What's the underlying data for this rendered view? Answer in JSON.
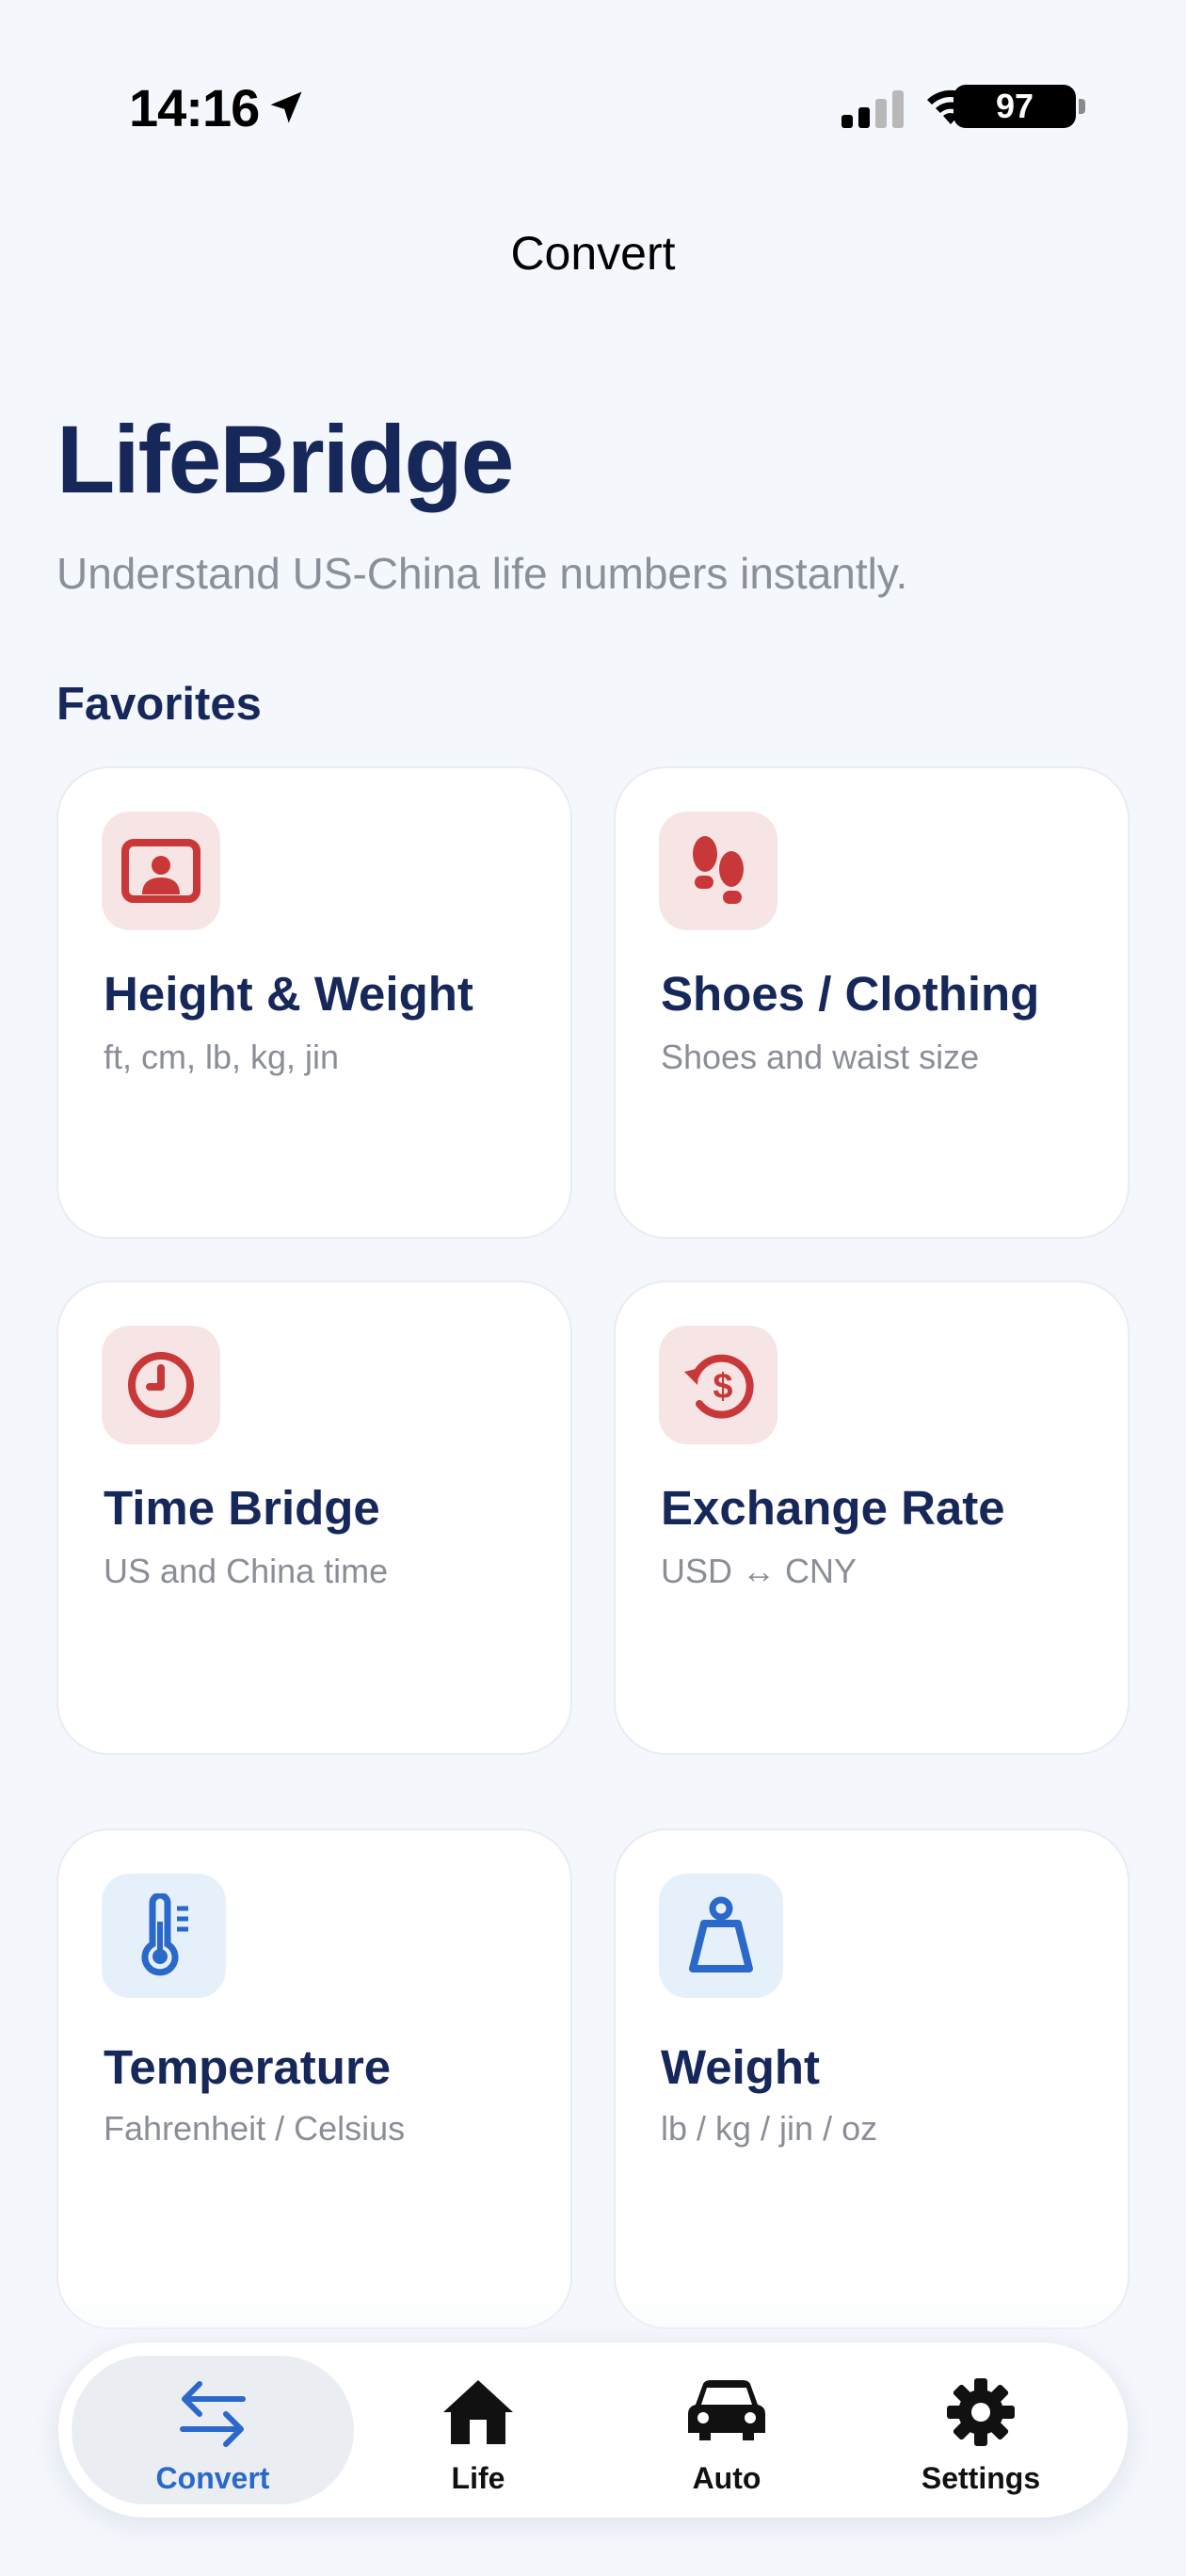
{
  "status_bar": {
    "time": "14:16",
    "battery": "97",
    "icons": [
      "location-arrow-icon",
      "signal-icon",
      "wifi-icon",
      "battery-icon"
    ]
  },
  "nav": {
    "title": "Convert"
  },
  "header": {
    "app_title": "LifeBridge",
    "subtitle": "Understand US-China life numbers instantly."
  },
  "favorites": {
    "title": "Favorites",
    "cards": [
      {
        "title": "Height & Weight",
        "subtitle": "ft, cm, lb, kg, jin",
        "icon": "person-id-icon"
      },
      {
        "title": "Shoes / Clothing",
        "subtitle": "Shoes and waist size",
        "icon": "footprints-icon"
      },
      {
        "title": "Time Bridge",
        "subtitle": "US and China time",
        "icon": "clock-icon"
      },
      {
        "title": "Exchange Rate",
        "subtitle": "USD ↔ CNY",
        "icon": "currency-exchange-icon"
      },
      {
        "title": "Temperature",
        "subtitle": "Fahrenheit / Celsius",
        "icon": "thermometer-icon"
      },
      {
        "title": "Weight",
        "subtitle": "lb / kg / jin / oz",
        "icon": "scale-weight-icon"
      }
    ]
  },
  "tab_bar": {
    "tabs": [
      {
        "label": "Convert",
        "icon": "arrows-exchange-icon",
        "active": true
      },
      {
        "label": "Life",
        "icon": "house-icon",
        "active": false
      },
      {
        "label": "Auto",
        "icon": "car-icon",
        "active": false
      },
      {
        "label": "Settings",
        "icon": "gear-icon",
        "active": false
      }
    ]
  },
  "colors": {
    "navy": "#16275a",
    "red_accent": "#c93838",
    "blue_accent": "#2a68c9",
    "background": "#f4f7fc"
  }
}
